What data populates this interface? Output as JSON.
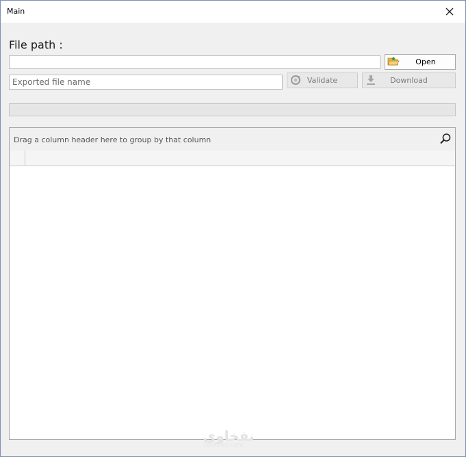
{
  "window": {
    "title": "Main"
  },
  "form": {
    "file_path_label": "File path :",
    "file_path_value": "",
    "exported_name_placeholder": "Exported file name",
    "exported_name_value": ""
  },
  "buttons": {
    "open_label": "Open",
    "validate_label": "Validate",
    "download_label": "Download"
  },
  "progress": {
    "value": 0
  },
  "grid": {
    "group_panel_text": "Drag a column header here to group by that column",
    "columns": [],
    "rows": []
  },
  "watermark": {
    "text": "نفخاوي",
    "sub": "nafxawy.com"
  },
  "icons": {
    "close": "close-icon",
    "open": "folder-open-icon",
    "validate": "refresh-icon",
    "download": "download-icon",
    "search": "search-icon"
  }
}
